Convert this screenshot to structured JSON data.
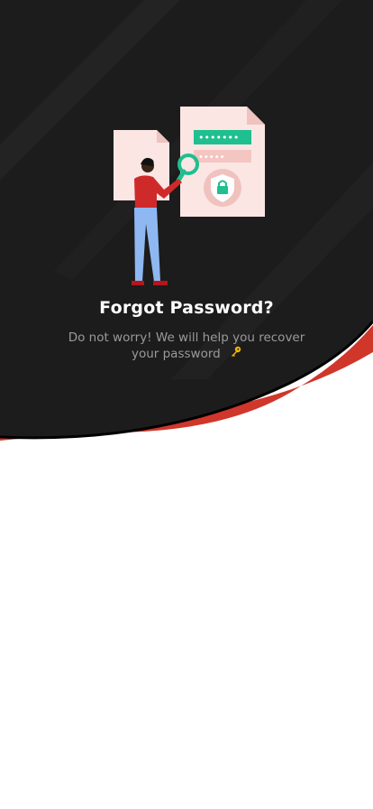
{
  "header": {
    "title": "Forgot Password?",
    "subtitle": "Do not worry! We will help you recover your password"
  },
  "illustration": {
    "password_mask": "•••••••",
    "hint_mask": "•••••"
  },
  "icons": {
    "subtitle_icon": "key-icon",
    "illustration": "person-inspecting-password-document"
  },
  "colors": {
    "background_dark": "#1c1c1c",
    "accent_red": "#d0362a",
    "accent_green": "#1fbf8f",
    "paper_pink": "#fbe6e4",
    "subtitle_gray": "#9a9a9a",
    "key_gold": "#f5b700"
  }
}
